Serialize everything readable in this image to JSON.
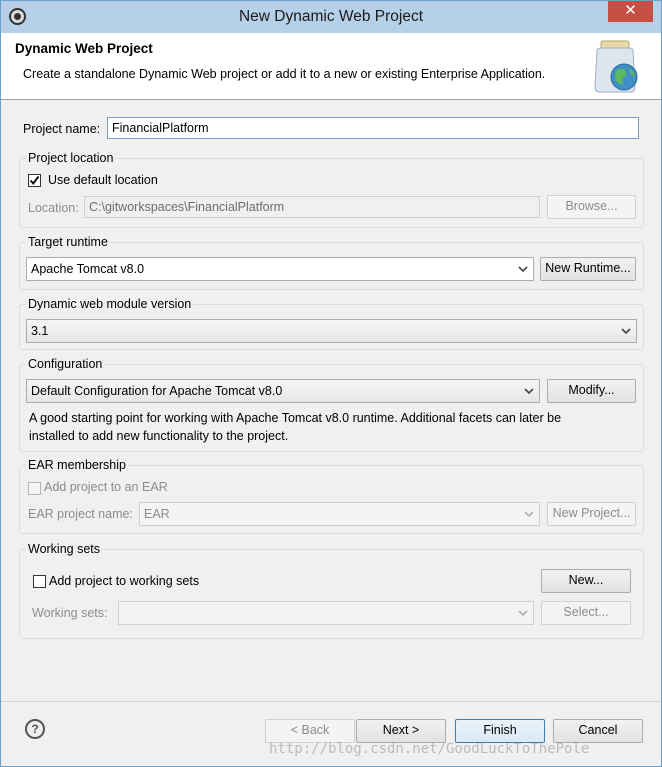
{
  "window": {
    "title": "New Dynamic Web Project",
    "close_label": "✕"
  },
  "header": {
    "title": "Dynamic Web Project",
    "description": "Create a standalone Dynamic Web project or add it to a new or existing Enterprise Application."
  },
  "project_name": {
    "label": "Project name:",
    "value": "FinancialPlatform"
  },
  "project_location": {
    "group_title": "Project location",
    "use_default_label": "Use default location",
    "use_default_checked": true,
    "location_label": "Location:",
    "location_value": "C:\\gitworkspaces\\FinancialPlatform",
    "browse_label": "Browse..."
  },
  "target_runtime": {
    "group_title": "Target runtime",
    "selected": "Apache Tomcat v8.0",
    "new_runtime_label": "New Runtime..."
  },
  "module_version": {
    "group_title": "Dynamic web module version",
    "selected": "3.1"
  },
  "configuration": {
    "group_title": "Configuration",
    "selected": "Default Configuration for Apache Tomcat v8.0",
    "modify_label": "Modify...",
    "description_line1": "A good starting point for working with Apache Tomcat v8.0 runtime. Additional facets can later be",
    "description_line2": "installed to add new functionality to the project."
  },
  "ear_membership": {
    "group_title": "EAR membership",
    "add_to_ear_label": "Add project to an EAR",
    "add_to_ear_checked": false,
    "ear_project_name_label": "EAR project name:",
    "ear_project_name_value": "EAR",
    "new_project_label": "New Project..."
  },
  "working_sets": {
    "group_title": "Working sets",
    "add_to_sets_label": "Add project to working sets",
    "add_to_sets_checked": false,
    "new_label": "New...",
    "working_sets_label": "Working sets:",
    "working_sets_value": "",
    "select_label": "Select..."
  },
  "footer": {
    "help_label": "?",
    "back_label": "< Back",
    "next_label": "Next >",
    "finish_label": "Finish",
    "cancel_label": "Cancel"
  },
  "watermark": "http://blog.csdn.net/GoodLuckToThePole",
  "colors": {
    "titlebar": "#b6d0ea",
    "close_button": "#c74f45",
    "dialog_bg": "#f0f0f0",
    "focus_border": "#7a9cc6"
  }
}
